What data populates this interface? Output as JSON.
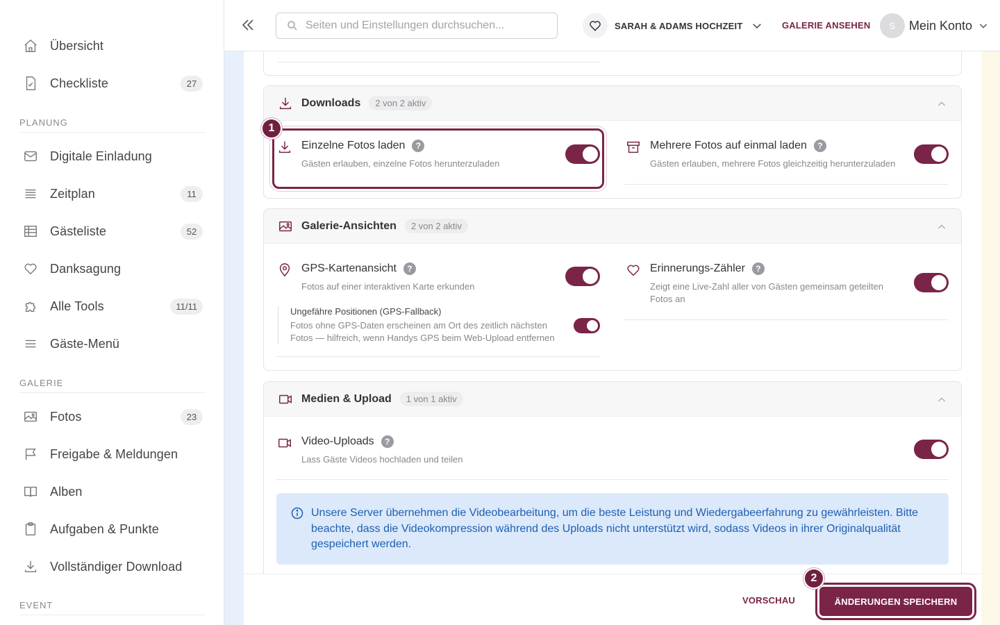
{
  "sidebar": {
    "items_top": [
      {
        "label": "Übersicht",
        "badge": ""
      },
      {
        "label": "Checkliste",
        "badge": "27"
      }
    ],
    "section_planung": "PLANUNG",
    "items_planung": [
      {
        "label": "Digitale Einladung",
        "badge": ""
      },
      {
        "label": "Zeitplan",
        "badge": "11"
      },
      {
        "label": "Gästeliste",
        "badge": "52"
      },
      {
        "label": "Danksagung",
        "badge": ""
      },
      {
        "label": "Alle Tools",
        "badge": "11/11"
      },
      {
        "label": "Gäste-Menü",
        "badge": ""
      }
    ],
    "section_galerie": "GALERIE",
    "items_galerie": [
      {
        "label": "Fotos",
        "badge": "23"
      },
      {
        "label": "Freigabe & Meldungen",
        "badge": ""
      },
      {
        "label": "Alben",
        "badge": ""
      },
      {
        "label": "Aufgaben & Punkte",
        "badge": ""
      },
      {
        "label": "Vollständiger Download",
        "badge": ""
      }
    ],
    "section_event": "EVENT"
  },
  "topbar": {
    "search_placeholder": "Seiten und Einstellungen durchsuchen...",
    "event_name": "SARAH & ADAMS HOCHZEIT",
    "gallery_link": "GALERIE ANSEHEN",
    "avatar_initial": "S",
    "account_label": "Mein Konto"
  },
  "cards": {
    "downloads": {
      "title": "Downloads",
      "count": "2 von 2 aktiv",
      "settings": [
        {
          "title": "Einzelne Fotos laden",
          "desc": "Gästen erlauben, einzelne Fotos herunterzuladen",
          "enabled": true
        },
        {
          "title": "Mehrere Fotos auf einmal laden",
          "desc": "Gästen erlauben, mehrere Fotos gleichzeitig herunterzuladen",
          "enabled": true
        }
      ]
    },
    "views": {
      "title": "Galerie-Ansichten",
      "count": "2 von 2 aktiv",
      "settings": [
        {
          "title": "GPS-Kartenansicht",
          "desc": "Fotos auf einer interaktiven Karte erkunden",
          "enabled": true
        },
        {
          "title": "Erinnerungs-Zähler",
          "desc": "Zeigt eine Live-Zahl aller von Gästen gemeinsam geteilten Fotos an",
          "enabled": true
        }
      ],
      "sub_setting": {
        "title": "Ungefähre Positionen (GPS-Fallback)",
        "desc": "Fotos ohne GPS-Daten erscheinen am Ort des zeitlich nächsten Fotos — hilfreich, wenn Handys GPS beim Web-Upload entfernen",
        "enabled": true
      }
    },
    "media": {
      "title": "Medien & Upload",
      "count": "1 von 1 aktiv",
      "settings": [
        {
          "title": "Video-Uploads",
          "desc": "Lass Gäste Videos hochladen und teilen",
          "enabled": true
        }
      ],
      "info": "Unsere Server übernehmen die Videobearbeitung, um die beste Leistung und Wiedergabeerfahrung zu gewährleisten. Bitte beachte, dass die Videokompression während des Uploads nicht unterstützt wird, sodass Videos in ihrer Originalqualität gespeichert werden."
    }
  },
  "annotations": {
    "step1": "1",
    "step2": "2"
  },
  "footer": {
    "preview_label": "VORSCHAU",
    "save_label": "ÄNDERUNGEN SPEICHERN"
  },
  "colors": {
    "accent": "#7a2448",
    "info_bg": "#dbe9fb",
    "info_text": "#1f5fb0"
  }
}
